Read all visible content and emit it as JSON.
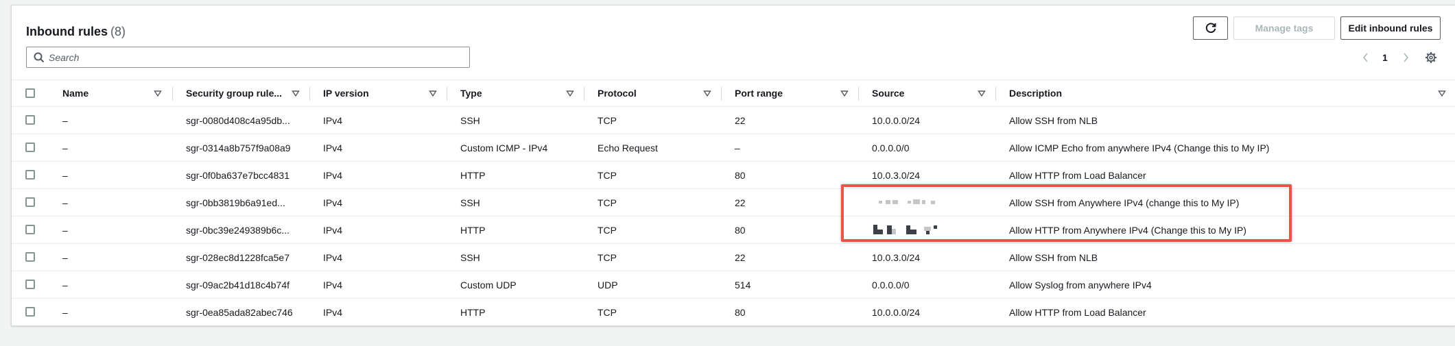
{
  "header": {
    "title": "Inbound rules",
    "count": "(8)",
    "manage_tags": "Manage tags",
    "edit_inbound": "Edit inbound rules"
  },
  "search": {
    "placeholder": "Search",
    "value": ""
  },
  "pagination": {
    "current_page": "1"
  },
  "columns": [
    "Name",
    "Security group rule...",
    "IP version",
    "Type",
    "Protocol",
    "Port range",
    "Source",
    "Description"
  ],
  "rows": [
    {
      "name": "–",
      "rule_id": "sgr-0080d408c4a95db...",
      "ip_version": "IPv4",
      "type": "SSH",
      "protocol": "TCP",
      "port_range": "22",
      "source": "10.0.0.0/24",
      "description": "Allow SSH from NLB"
    },
    {
      "name": "–",
      "rule_id": "sgr-0314a8b757f9a08a9",
      "ip_version": "IPv4",
      "type": "Custom ICMP - IPv4",
      "protocol": "Echo Request",
      "port_range": "–",
      "source": "0.0.0.0/0",
      "description": "Allow ICMP Echo from anywhere IPv4 (Change this to My IP)"
    },
    {
      "name": "–",
      "rule_id": "sgr-0f0ba637e7bcc4831",
      "ip_version": "IPv4",
      "type": "HTTP",
      "protocol": "TCP",
      "port_range": "80",
      "source": "10.0.3.0/24",
      "description": "Allow HTTP from Load Balancer"
    },
    {
      "name": "–",
      "rule_id": "sgr-0bb3819b6a91ed...",
      "ip_version": "IPv4",
      "type": "SSH",
      "protocol": "TCP",
      "port_range": "22",
      "source": "",
      "description": "Allow SSH from Anywhere IPv4 (change this to My IP)"
    },
    {
      "name": "–",
      "rule_id": "sgr-0bc39e249389b6c...",
      "ip_version": "IPv4",
      "type": "HTTP",
      "protocol": "TCP",
      "port_range": "80",
      "source": "",
      "description": "Allow HTTP from Anywhere IPv4 (Change this to My IP)"
    },
    {
      "name": "–",
      "rule_id": "sgr-028ec8d1228fca5e7",
      "ip_version": "IPv4",
      "type": "SSH",
      "protocol": "TCP",
      "port_range": "22",
      "source": "10.0.3.0/24",
      "description": "Allow SSH from NLB"
    },
    {
      "name": "–",
      "rule_id": "sgr-09ac2b41d18c4b74f",
      "ip_version": "IPv4",
      "type": "Custom UDP",
      "protocol": "UDP",
      "port_range": "514",
      "source": "0.0.0.0/0",
      "description": "Allow Syslog from anywhere IPv4"
    },
    {
      "name": "–",
      "rule_id": "sgr-0ea85ada82abec746",
      "ip_version": "IPv4",
      "type": "HTTP",
      "protocol": "TCP",
      "port_range": "80",
      "source": "10.0.0.0/24",
      "description": "Allow HTTP from Load Balancer"
    }
  ],
  "icons": {
    "refresh": "refresh-icon",
    "search": "search-icon",
    "prev": "chevron-left-icon",
    "next": "chevron-right-icon",
    "settings": "gear-icon",
    "sort": "sort-caret-icon"
  },
  "colors": {
    "highlight_border": "#e8564a",
    "text": "#16191f",
    "muted": "#545b64",
    "border": "#d5dbdb"
  }
}
